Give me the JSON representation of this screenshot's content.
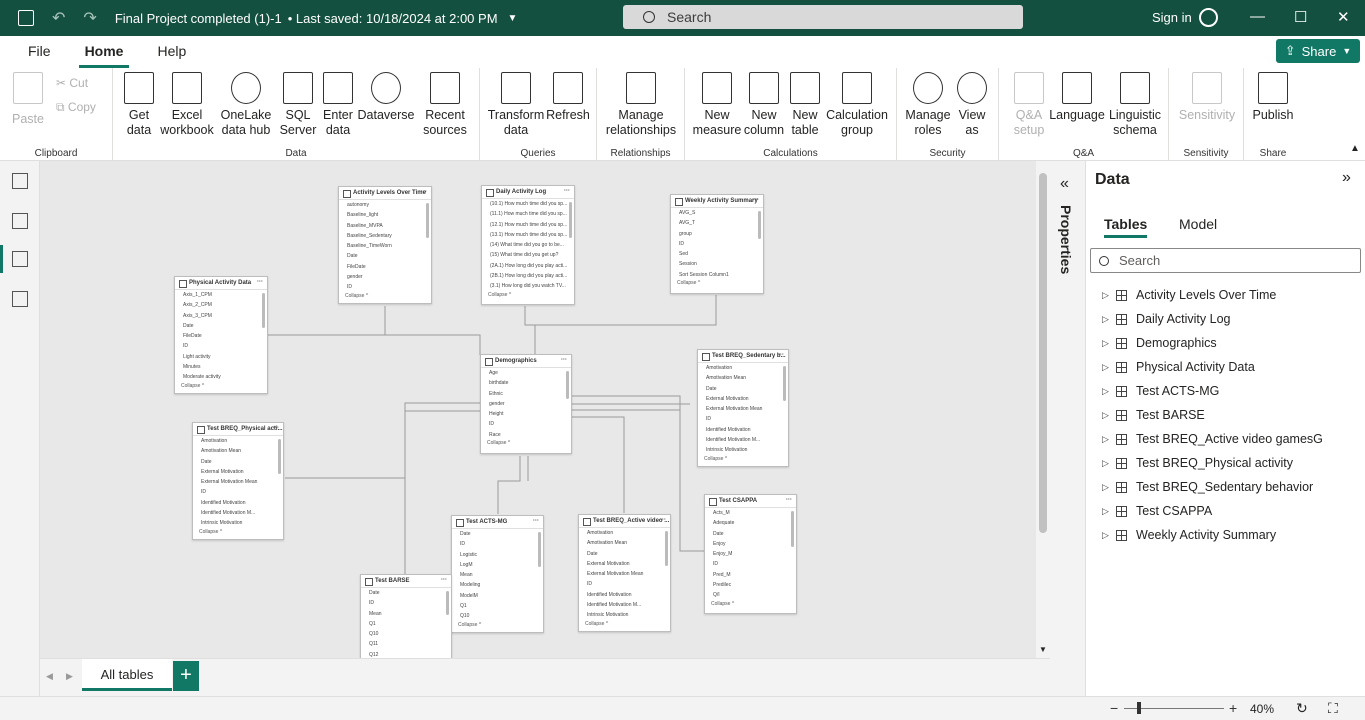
{
  "titlebar": {
    "file_title": "Final Project completed (1)-1",
    "saved": "• Last saved: 10/18/2024 at 2:00 PM",
    "search_placeholder": "Search",
    "signin": "Sign in"
  },
  "menu": {
    "items": [
      "File",
      "Home",
      "Help"
    ],
    "share": "Share"
  },
  "ribbon": {
    "clipboard": {
      "label": "Clipboard",
      "paste": "Paste",
      "cut": "Cut",
      "copy": "Copy"
    },
    "data": {
      "label": "Data",
      "get_data": "Get data",
      "excel": "Excel workbook",
      "onelake": "OneLake data hub",
      "sql": "SQL Server",
      "enter": "Enter data",
      "dataverse": "Dataverse",
      "recent": "Recent sources"
    },
    "queries": {
      "label": "Queries",
      "transform": "Transform data",
      "refresh": "Refresh"
    },
    "relationships": {
      "label": "Relationships",
      "manage": "Manage relationships"
    },
    "calculations": {
      "label": "Calculations",
      "measure": "New measure",
      "column": "New column",
      "table": "New table",
      "calc_group": "Calculation group"
    },
    "security": {
      "label": "Security",
      "manage_roles": "Manage roles",
      "view_as": "View as"
    },
    "qa": {
      "label": "Q&A",
      "setup": "Q&A setup",
      "language": "Language",
      "schema": "Linguistic schema"
    },
    "sensitivity": {
      "label": "Sensitivity",
      "btn": "Sensitivity"
    },
    "share": {
      "label": "Share",
      "publish": "Publish"
    }
  },
  "canvas_tables": [
    {
      "name": "Activity Levels Over Time",
      "fields": [
        "autonomy",
        "Baseline_light",
        "Baseline_MVPA",
        "Baseline_Sedentary",
        "Baseline_TimeWorn",
        "Date",
        "FileDate",
        "gender",
        "ID"
      ],
      "collapse": "Collapse ^"
    },
    {
      "name": "Daily Activity Log",
      "fields": [
        "(10.1) How much time did you sp...",
        "(11.1) How much time did you sp...",
        "(12.1) How much time did you sp...",
        "(13.1) How much time did you sp...",
        "(14) What time did you go to be...",
        "(15) What time did you get up?",
        "(2A.1) How long did you play acti...",
        "(2B.1) How long did you play acti...",
        "(3.1) How long did you watch TV..."
      ],
      "collapse": "Collapse ^"
    },
    {
      "name": "Weekly Activity Summary",
      "fields": [
        "AVG_S",
        "AVG_T",
        "group",
        "ID",
        "Sed",
        "Session",
        "Sort Session Column1"
      ],
      "collapse": "Collapse ^"
    },
    {
      "name": "Physical Activity Data",
      "fields": [
        "Axis_1_CPM",
        "Axis_2_CPM",
        "Axis_3_CPM",
        "Date",
        "FileDate",
        "ID",
        "Light activity",
        "Minutes",
        "Moderate activity"
      ],
      "collapse": "Collapse ^"
    },
    {
      "name": "Demographics",
      "fields": [
        "Age",
        "birthdate",
        "Ethnic",
        "gender",
        "Height",
        "ID",
        "Race"
      ],
      "collapse": "Collapse ^"
    },
    {
      "name": "Test BREQ_Sedentary b...",
      "fields": [
        "Amotivation",
        "Amotivation Mean",
        "Date",
        "External Motivation",
        "External Motivation Mean",
        "ID",
        "Identified Motivation",
        "Identified Motivation M...",
        "Intrinsic Motivation"
      ],
      "collapse": "Collapse ^"
    },
    {
      "name": "Test BREQ_Physical acti...",
      "fields": [
        "Amotivation",
        "Amotivation Mean",
        "Date",
        "External Motivation",
        "External Motivation Mean",
        "ID",
        "Identified Motivation",
        "Identified Motivation M...",
        "Intrinsic Motivation"
      ],
      "collapse": "Collapse ^"
    },
    {
      "name": "Test CSAPPA",
      "fields": [
        "Acts_M",
        "Adequate",
        "Date",
        "Enjoy",
        "Enjoy_M",
        "ID",
        "Pred_M",
        "Predilec",
        "Q/I"
      ],
      "collapse": "Collapse ^"
    },
    {
      "name": "Test ACTS-MG",
      "fields": [
        "Date",
        "ID",
        "Logistic",
        "LogM",
        "Mean",
        "Modeling",
        "ModelM",
        "Q1",
        "Q10"
      ],
      "collapse": "Collapse ^"
    },
    {
      "name": "Test BREQ_Active video ...",
      "fields": [
        "Amotivation",
        "Amotivation Mean",
        "Date",
        "External Motivation",
        "External Motivation Mean",
        "ID",
        "Identified Motivation",
        "Identified Motivation M...",
        "Intrinsic Motivation"
      ],
      "collapse": "Collapse ^"
    },
    {
      "name": "Test BARSE",
      "fields": [
        "Date",
        "ID",
        "Mean",
        "Q1",
        "Q10",
        "Q11",
        "Q12"
      ],
      "collapse": ""
    }
  ],
  "tabs": {
    "all_tables": "All tables",
    "add": "+"
  },
  "properties": {
    "label": "Properties"
  },
  "data_pane": {
    "title": "Data",
    "tabs": [
      "Tables",
      "Model"
    ],
    "search_placeholder": "Search",
    "tables": [
      "Activity Levels Over Time",
      "Daily Activity Log",
      "Demographics",
      "Physical Activity Data",
      "Test ACTS-MG",
      "Test BARSE",
      "Test BREQ_Active video gamesG",
      "Test BREQ_Physical activity",
      "Test BREQ_Sedentary behavior",
      "Test CSAPPA",
      "Weekly Activity Summary"
    ]
  },
  "status": {
    "zoom": "40%"
  },
  "colors": {
    "accent": "#117865",
    "titlebar": "#14503f"
  }
}
